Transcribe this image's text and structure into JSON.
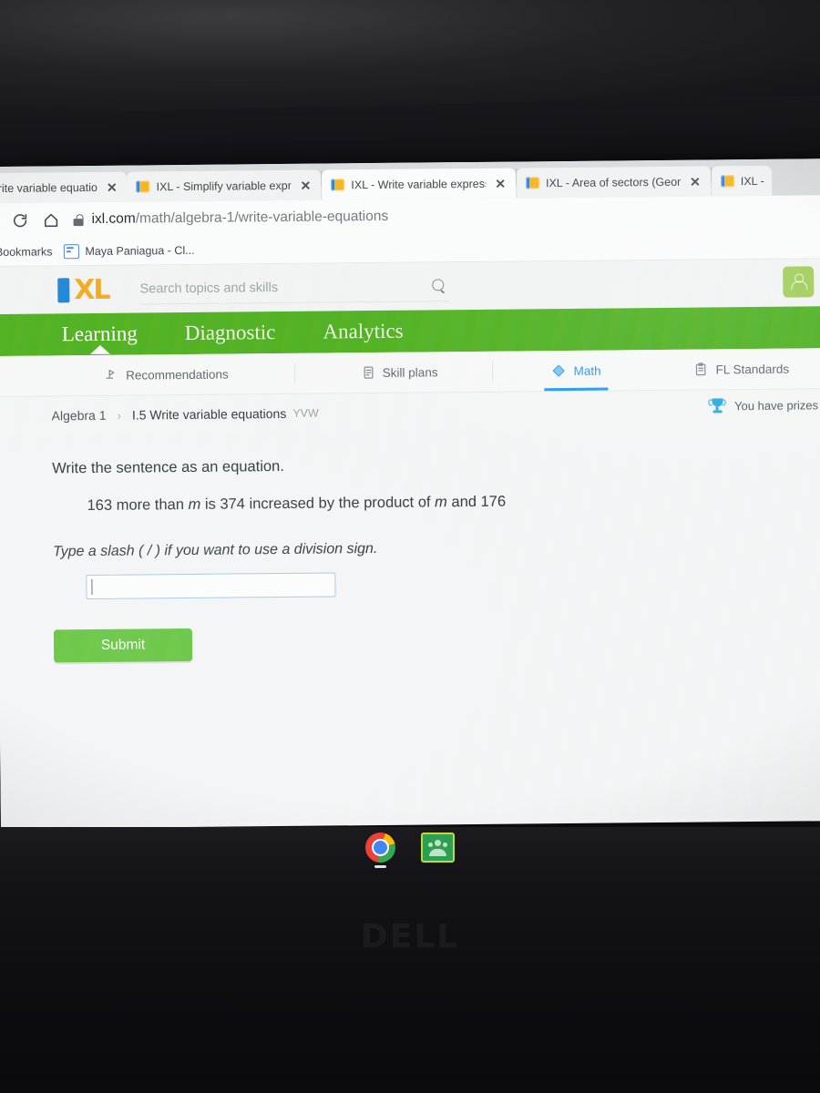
{
  "browser": {
    "tabs": [
      {
        "title": "Write variable equatio",
        "favicon": "ixl-favicon",
        "active": false,
        "partial_left": true
      },
      {
        "title": "IXL - Simplify variable expre",
        "favicon": "ixl-favicon",
        "active": false
      },
      {
        "title": "IXL - Write variable express",
        "favicon": "ixl-favicon",
        "active": true
      },
      {
        "title": "IXL - Area of sectors (Geom",
        "favicon": "ixl-favicon",
        "active": false
      },
      {
        "title": "IXL -",
        "favicon": "ixl-favicon",
        "active": false,
        "partial_right": true
      }
    ],
    "close_glyph": "✕",
    "toolbar": {
      "reload_icon": "reload-icon",
      "home_icon": "home-icon",
      "lock_icon": "lock-icon",
      "url_host": "ixl.com",
      "url_path": "/math/algebra-1/write-variable-equations"
    },
    "bookmarks_bar": {
      "label": "Bookmarks",
      "items": [
        {
          "label": "Maya Paniagua - Cl...",
          "icon": "doc-icon"
        }
      ]
    }
  },
  "ixl": {
    "logo": {
      "i": "I",
      "xl": "XL"
    },
    "search": {
      "placeholder": "Search topics and skills",
      "icon": "search-icon"
    },
    "avatar": {
      "icon": "account-icon"
    },
    "primary_nav": [
      {
        "label": "Learning",
        "active": true
      },
      {
        "label": "Diagnostic",
        "active": false
      },
      {
        "label": "Analytics",
        "active": false
      }
    ],
    "sub_nav": [
      {
        "label": "Recommendations",
        "icon": "recommendations-icon",
        "active": false
      },
      {
        "label": "Skill plans",
        "icon": "skill-plans-icon",
        "active": false
      },
      {
        "label": "Math",
        "icon": "math-icon",
        "active": true
      },
      {
        "label": "FL Standards",
        "icon": "standards-icon",
        "active": false
      }
    ],
    "breadcrumb": {
      "course": "Algebra 1",
      "separator": "›",
      "skill": "I.5 Write variable equations",
      "code": "YVW"
    },
    "prizes": {
      "icon": "trophy-icon",
      "text": "You have prizes to"
    },
    "question": {
      "prompt": "Write the sentence as an equation.",
      "sentence_parts": [
        {
          "text": "163 more than ",
          "italic": false
        },
        {
          "text": "m",
          "italic": true
        },
        {
          "text": " is 374 increased by the product of ",
          "italic": false
        },
        {
          "text": "m",
          "italic": true
        },
        {
          "text": " and 176",
          "italic": false
        }
      ],
      "sentence_plain": "163 more than m is 374 increased by the product of m and 176",
      "hint": "Type a slash ( / ) if you want to use a division sign.",
      "answer_value": "",
      "submit_label": "Submit"
    },
    "colors": {
      "green_bar": "#4caf1b",
      "submit_green": "#58c034",
      "active_blue": "#2196f3",
      "logo_blue": "#1b84d6",
      "logo_orange": "#f2a81d"
    }
  },
  "desktop": {
    "taskbar_icons": [
      {
        "name": "chrome-icon"
      },
      {
        "name": "google-classroom-icon"
      }
    ],
    "laptop_brand": "DELL"
  }
}
